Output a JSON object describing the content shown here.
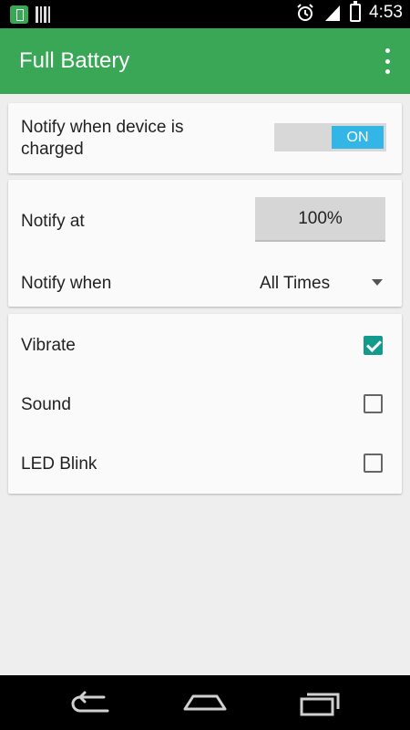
{
  "status_bar": {
    "time": "4:53",
    "icons": [
      "battery-app-icon",
      "barcode-icon",
      "alarm-icon",
      "signal-icon",
      "battery-charging-icon"
    ]
  },
  "app_bar": {
    "title": "Full Battery",
    "menu_icon": "overflow-menu-icon"
  },
  "charge_card": {
    "label": "Notify when device is charged",
    "toggle_label": "ON",
    "toggle_on": true
  },
  "notify_card": {
    "notify_at_label": "Notify at",
    "notify_at_value": "100%",
    "notify_when_label": "Notify when",
    "notify_when_value": "All Times"
  },
  "options_card": {
    "items": [
      {
        "label": "Vibrate",
        "checked": true
      },
      {
        "label": "Sound",
        "checked": false
      },
      {
        "label": "LED Blink",
        "checked": false
      }
    ]
  },
  "colors": {
    "app_bar": "#3aa757",
    "toggle_accent": "#33b5e5",
    "checkbox_accent": "#129a8d"
  },
  "nav_bar": {
    "icons": [
      "back-icon",
      "home-icon",
      "recent-apps-icon"
    ]
  }
}
